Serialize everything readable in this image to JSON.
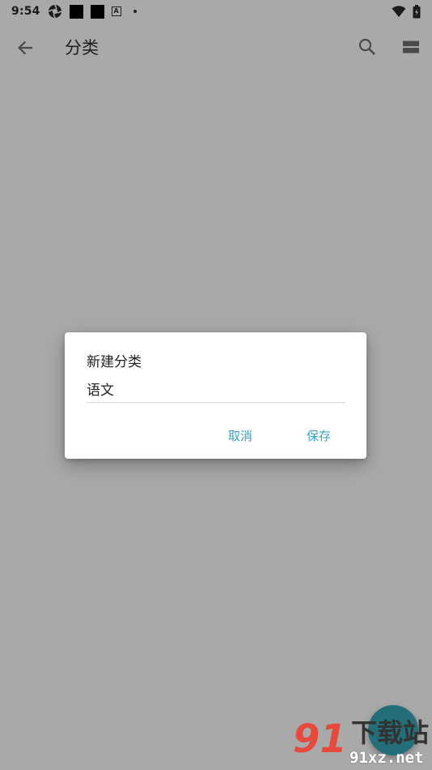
{
  "status_bar": {
    "time": "9:54",
    "icons": [
      "camera-aperture-icon",
      "notification-square-icon",
      "notification-square-icon",
      "font-a-icon",
      "dot-icon",
      "wifi-icon",
      "battery-icon"
    ]
  },
  "app_bar": {
    "title": "分类",
    "icons": [
      "arrow-back-icon",
      "search-icon",
      "view-list-icon"
    ]
  },
  "dialog": {
    "title": "新建分类",
    "input_value": "语文",
    "cancel_label": "取消",
    "save_label": "保存"
  },
  "watermark": {
    "brand": "91",
    "cn_text": "下载站",
    "url": "91xz.net"
  },
  "colors": {
    "scrim_background": "#a9a9a9",
    "dialog_background": "#ffffff",
    "accent": "#3aa3c0",
    "fab": "#236e78",
    "watermark_red": "#e64a3c"
  }
}
